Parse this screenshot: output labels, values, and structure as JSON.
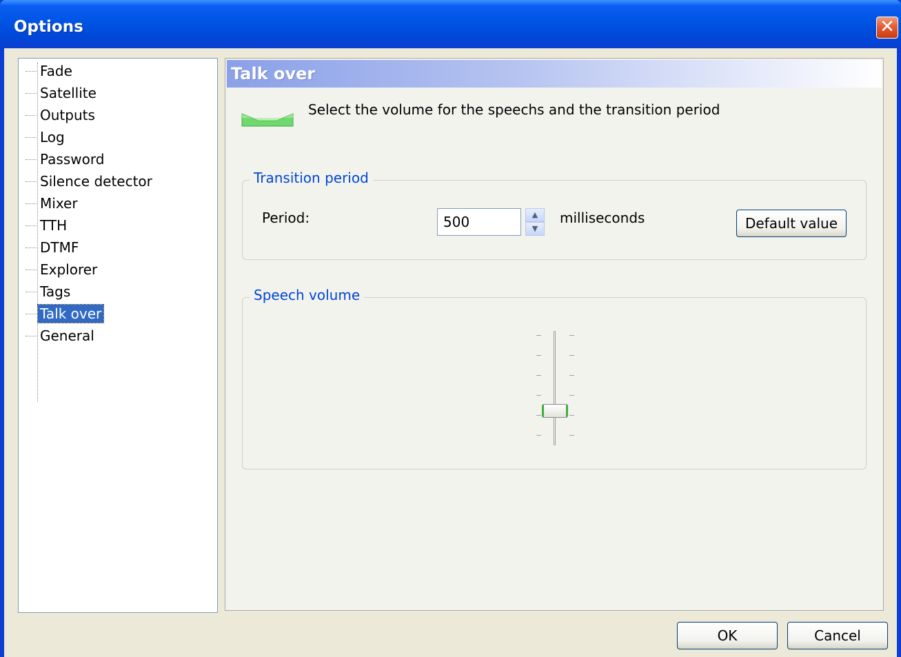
{
  "window": {
    "title": "Options",
    "close_label": "✕"
  },
  "tree": {
    "items": [
      {
        "label": "Fade"
      },
      {
        "label": "Satellite"
      },
      {
        "label": "Outputs"
      },
      {
        "label": "Log"
      },
      {
        "label": "Password"
      },
      {
        "label": "Silence detector"
      },
      {
        "label": "Mixer"
      },
      {
        "label": "TTH"
      },
      {
        "label": "DTMF"
      },
      {
        "label": "Explorer"
      },
      {
        "label": "Tags"
      },
      {
        "label": "Talk over",
        "selected": true
      },
      {
        "label": "General"
      }
    ]
  },
  "panel": {
    "header": "Talk over",
    "description": "Select the volume for the speechs and the transition period",
    "icon": "talk-over-icon",
    "transition": {
      "legend": "Transition period",
      "period_label": "Period:",
      "period_value": "500",
      "unit_label": "milliseconds",
      "default_button": "Default value"
    },
    "speech": {
      "legend": "Speech volume",
      "level_fraction": 0.2
    }
  },
  "buttons": {
    "ok": "OK",
    "cancel": "Cancel"
  },
  "colors": {
    "titlebar": "#0054e3",
    "selection": "#316ac5",
    "legend_text": "#0046d5",
    "icon_green": "#5ccf5c"
  }
}
